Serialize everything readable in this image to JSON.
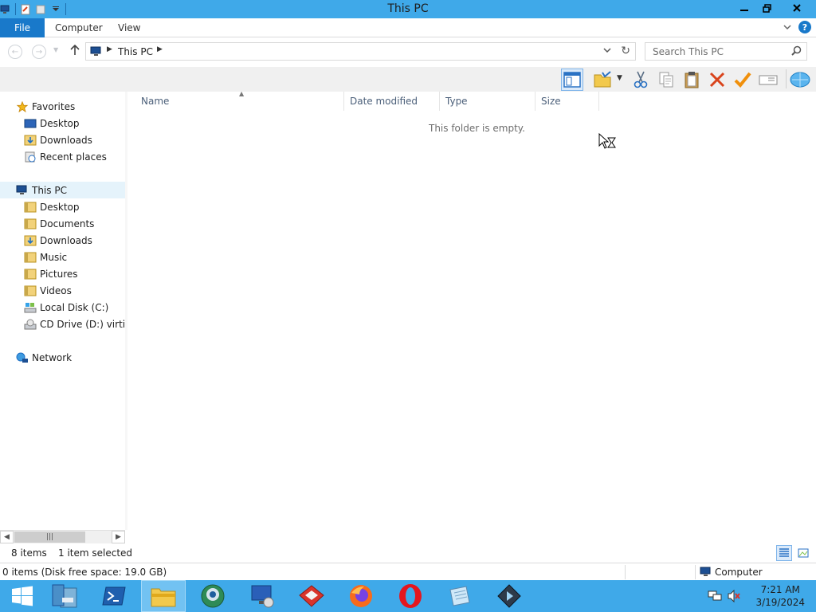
{
  "window": {
    "title": "This PC"
  },
  "quick_access_toolbar": [
    "computer-icon",
    "properties-icon",
    "new-folder-icon",
    "customize-chevron-icon"
  ],
  "ribbon": {
    "tabs": [
      {
        "label": "File"
      },
      {
        "label": "Computer"
      },
      {
        "label": "View"
      }
    ]
  },
  "address": {
    "crumbs": [
      "This PC"
    ]
  },
  "search": {
    "placeholder": "Search This PC"
  },
  "toolbar": {
    "buttons": [
      "preview-pane-icon",
      "folder-options-icon",
      "cut-icon",
      "copy-icon",
      "paste-icon",
      "delete-icon",
      "select-icon",
      "rename-icon",
      "shell-icon"
    ]
  },
  "nav": {
    "favorites": {
      "label": "Favorites",
      "items": [
        {
          "label": "Desktop"
        },
        {
          "label": "Downloads"
        },
        {
          "label": "Recent places"
        }
      ]
    },
    "this_pc": {
      "label": "This PC",
      "items": [
        {
          "label": "Desktop"
        },
        {
          "label": "Documents"
        },
        {
          "label": "Downloads"
        },
        {
          "label": "Music"
        },
        {
          "label": "Pictures"
        },
        {
          "label": "Videos"
        },
        {
          "label": "Local Disk (C:)"
        },
        {
          "label": "CD Drive (D:) virtio-win"
        }
      ]
    },
    "network": {
      "label": "Network"
    }
  },
  "columns": [
    "Name",
    "Date modified",
    "Type",
    "Size"
  ],
  "content": {
    "empty_message": "This folder is empty."
  },
  "status": {
    "item_count": "8 items",
    "selection": "1 item selected"
  },
  "details": {
    "info": "0 items (Disk free space: 19.0 GB)",
    "location": "Computer"
  },
  "taskbar": {
    "apps": [
      "start-icon",
      "server-manager-icon",
      "powershell-icon",
      "file-explorer-icon",
      "network-globe-icon",
      "remote-desktop-icon",
      "red-app-icon",
      "firefox-icon",
      "opera-icon",
      "notepad-icon",
      "media-player-icon"
    ],
    "time": "7:21 AM",
    "date": "3/19/2024"
  },
  "colors": {
    "accent": "#3fa9e9",
    "file_tab": "#1979ca"
  }
}
